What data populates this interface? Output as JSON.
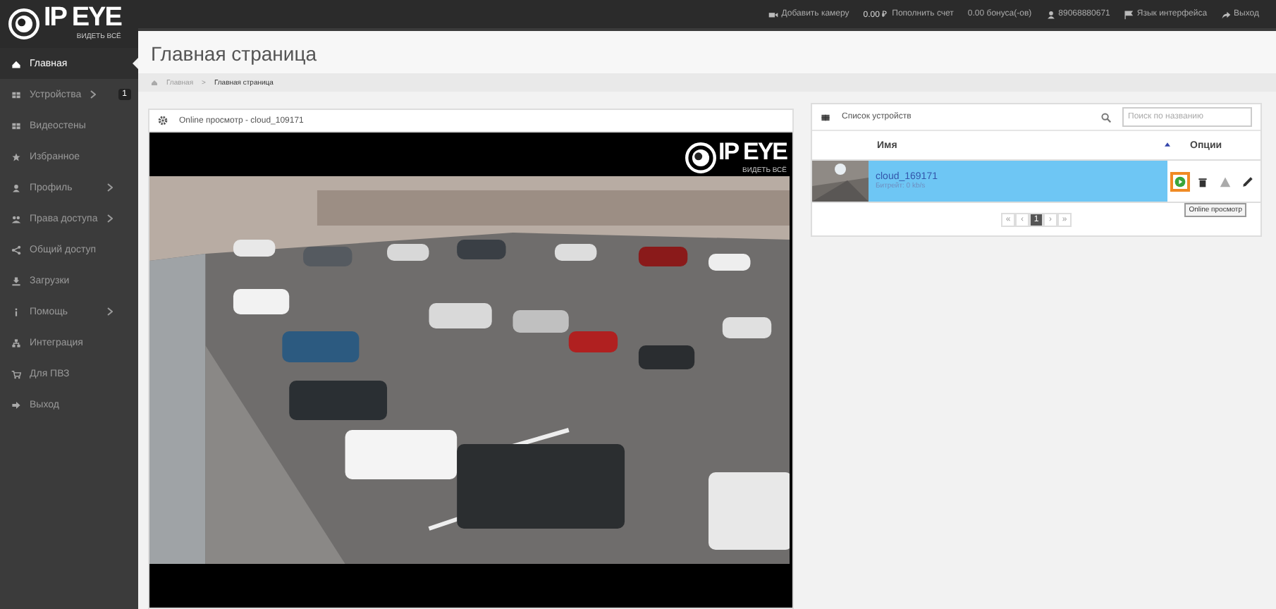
{
  "logo": {
    "text": "IP EYE",
    "tagline": "ВИДЕТЬ ВСЁ"
  },
  "top_bar": [
    {
      "kind": "camera",
      "label": "Добавить камеру"
    },
    {
      "kind": "balance",
      "amount": "0.00 ₽",
      "label": "Пополнить счет"
    },
    {
      "kind": "plain",
      "label": "0.00 бонуса(-ов)"
    },
    {
      "kind": "user",
      "label": "89068880671"
    },
    {
      "kind": "flag",
      "label": "Язык интерфейса"
    },
    {
      "kind": "exit",
      "label": "Выход"
    }
  ],
  "sidebar": {
    "items": [
      {
        "label": "Главная",
        "selected": true,
        "submenu": false
      },
      {
        "label": "Устройства",
        "selected": false,
        "submenu": true,
        "badge": "1"
      },
      {
        "label": "Видеостены",
        "selected": false,
        "submenu": false
      },
      {
        "label": "Избранное",
        "selected": false,
        "submenu": false
      },
      {
        "label": "Профиль",
        "selected": false,
        "submenu": true
      },
      {
        "label": "Права доступа",
        "selected": false,
        "submenu": true
      },
      {
        "label": "Общий доступ",
        "selected": false,
        "submenu": false
      },
      {
        "label": "Загрузки",
        "selected": false,
        "submenu": false
      },
      {
        "label": "Помощь",
        "selected": false,
        "submenu": true
      },
      {
        "label": "Интеграция",
        "selected": false,
        "submenu": false
      },
      {
        "label": "Для ПВЗ",
        "selected": false,
        "submenu": false
      },
      {
        "label": "Выход",
        "selected": false,
        "submenu": false
      }
    ]
  },
  "page": {
    "title": "Главная страница",
    "breadcrumbs": [
      "Главная",
      "Главная страница"
    ],
    "breadcrumb_separator": ">"
  },
  "video_panel": {
    "title": "Online просмотр - cloud_109171",
    "overlay_logo": "IP EYE",
    "overlay_tagline": "ВИДЕТЬ ВСЁ"
  },
  "devices_panel": {
    "title": "Список устройств",
    "search": {
      "placeholder": "Поиск по названию"
    },
    "columns": [
      "Имя",
      "Опции"
    ],
    "rows": [
      {
        "name": "cloud_169171",
        "bitrate": "Битрейт: 0 kb/s",
        "selected": true,
        "actions": [
          {
            "kind": "play",
            "hovered": true
          },
          {
            "kind": "trash",
            "hovered": false
          },
          {
            "kind": "warning",
            "hovered": false
          },
          {
            "kind": "edit",
            "hovered": false
          }
        ]
      }
    ],
    "tooltip": "Online просмотр",
    "pagination": [
      {
        "label": "«",
        "selected": false
      },
      {
        "label": "‹",
        "selected": false
      },
      {
        "label": "1",
        "selected": true
      },
      {
        "label": "›",
        "selected": false
      },
      {
        "label": "»",
        "selected": false
      }
    ]
  }
}
